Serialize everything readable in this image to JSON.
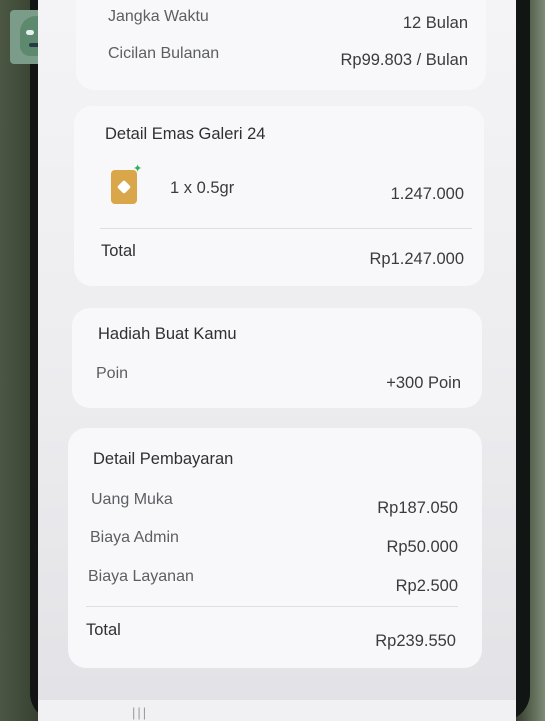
{
  "tenor": {
    "jangka_waktu_label": "Jangka Waktu",
    "jangka_waktu_value": "12 Bulan",
    "cicilan_label": "Cicilan Bulanan",
    "cicilan_value": "Rp99.803 / Bulan"
  },
  "detail_emas": {
    "title": "Detail Emas Galeri 24",
    "item_icon": "gold-bar-icon",
    "item_qty": "1 x 0.5gr",
    "item_price": "1.247.000",
    "total_label": "Total",
    "total_value": "Rp1.247.000"
  },
  "hadiah": {
    "title": "Hadiah Buat Kamu",
    "poin_label": "Poin",
    "poin_value": "+300 Poin"
  },
  "pembayaran": {
    "title": "Detail Pembayaran",
    "rows": [
      {
        "label": "Uang Muka",
        "value": "Rp187.050"
      },
      {
        "label": "Biaya Admin",
        "value": "Rp50.000"
      },
      {
        "label": "Biaya Layanan",
        "value": "Rp2.500"
      }
    ],
    "total_label": "Total",
    "total_value": "Rp239.550"
  },
  "bottom_nav": {
    "menu_glyph": "|||"
  },
  "colors": {
    "screen_bg": "#f4f4f6",
    "card_bg": "#f8f8fa",
    "gold": "#d9a74a",
    "accent_green": "#2fae5a"
  }
}
